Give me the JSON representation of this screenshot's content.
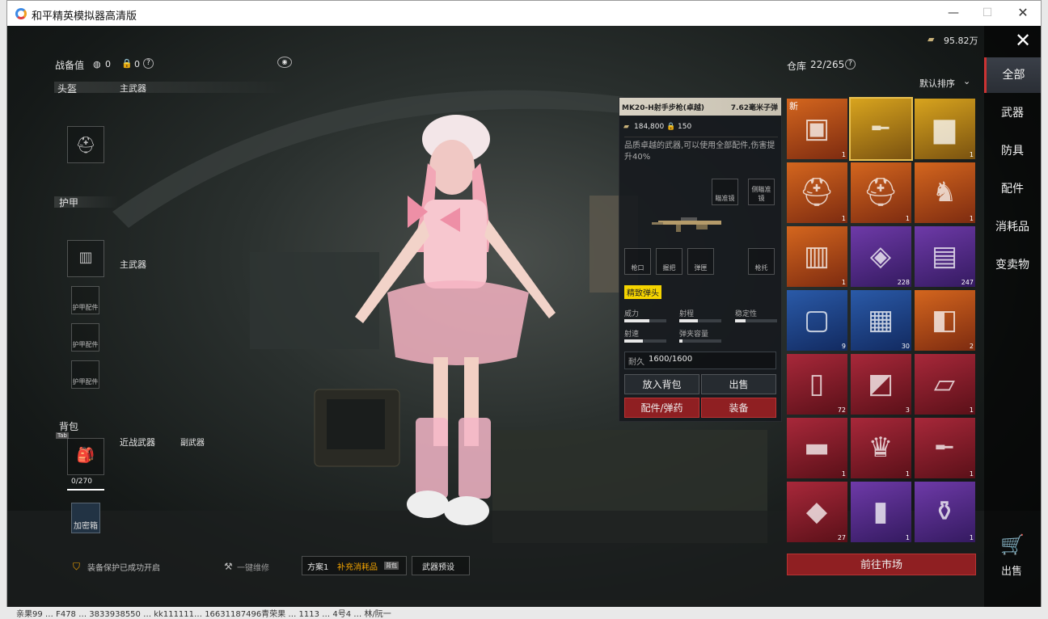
{
  "window": {
    "title": "和平精英模拟器高清版"
  },
  "left": {
    "gear_value_label": "战备值",
    "gear_value": "0",
    "lock_value": "0",
    "helmet": "头盔",
    "main_weapon": "主武器",
    "armor": "护甲",
    "main_weapon2": "主武器",
    "armor_part": "护甲配件",
    "backpack": "背包",
    "backpack_tab": "Tab",
    "backpack_capacity": "0/270",
    "melee": "近战武器",
    "secondary": "副武器",
    "encrypt_box": "加密箱",
    "protect_text": "装备保护已成功开启",
    "repair": "一键维修",
    "plan": "方案1",
    "supply": "补充消耗品",
    "supply_tag": "背包",
    "weapon_preset": "武器预设"
  },
  "currency": "95.82万",
  "storage": {
    "label": "仓库",
    "count": "22/265",
    "sort": "默认排序"
  },
  "info": {
    "name": "MK20-H射手步枪(卓越)",
    "caliber": "7.62毫米子弹",
    "price": "184,800",
    "weight": "150",
    "desc": "品质卓越的武器,可以使用全部配件,伤害提升40%",
    "slots": [
      "瞄准镜",
      "侧瞄准镜",
      "枪口",
      "握把",
      "弹匣",
      "枪托"
    ],
    "ammo_tag": "精致弹头",
    "stats": [
      {
        "name": "威力",
        "v": 0.6
      },
      {
        "name": "射程",
        "v": 0.45
      },
      {
        "name": "稳定性",
        "v": 0.25
      },
      {
        "name": "射速",
        "v": 0.45
      },
      {
        "name": "弹夹容量",
        "v": 0.08
      }
    ],
    "durability_label": "耐久",
    "durability": "1600/1600",
    "btn_pack": "放入背包",
    "btn_sell": "出售",
    "btn_parts": "配件/弹药",
    "btn_equip": "装备"
  },
  "grid": [
    {
      "name": "supply-crate",
      "bg": "orange",
      "count": "1",
      "tag": "新"
    },
    {
      "name": "rifle",
      "bg": "gold",
      "count": "",
      "tag": ""
    },
    {
      "name": "backpack",
      "bg": "gold",
      "count": "1",
      "tag": ""
    },
    {
      "name": "helmet",
      "bg": "orange",
      "count": "1",
      "tag": ""
    },
    {
      "name": "helmet",
      "bg": "orange",
      "count": "1",
      "tag": ""
    },
    {
      "name": "armor-suit",
      "bg": "orange",
      "count": "1",
      "tag": ""
    },
    {
      "name": "vest",
      "bg": "orange",
      "count": "1",
      "tag": ""
    },
    {
      "name": "ticket",
      "bg": "purple",
      "count": "228",
      "tag": ""
    },
    {
      "name": "ammo-box",
      "bg": "purple",
      "count": "247",
      "tag": ""
    },
    {
      "name": "silver-case",
      "bg": "blue",
      "count": "9",
      "tag": ""
    },
    {
      "name": "metal-case",
      "bg": "blue",
      "count": "30",
      "tag": ""
    },
    {
      "name": "gold-card",
      "bg": "orange",
      "count": "2",
      "tag": ""
    },
    {
      "name": "book",
      "bg": "red2",
      "count": "72",
      "tag": ""
    },
    {
      "name": "blue-card",
      "bg": "red2",
      "count": "3",
      "tag": ""
    },
    {
      "name": "map",
      "bg": "red2",
      "count": "1",
      "tag": ""
    },
    {
      "name": "gold-bar",
      "bg": "red2",
      "count": "1",
      "tag": ""
    },
    {
      "name": "trophy",
      "bg": "red2",
      "count": "1",
      "tag": ""
    },
    {
      "name": "gun",
      "bg": "red2",
      "count": "1",
      "tag": ""
    },
    {
      "name": "diamonds",
      "bg": "red2",
      "count": "27",
      "tag": ""
    },
    {
      "name": "passport",
      "bg": "purple",
      "count": "1",
      "tag": ""
    },
    {
      "name": "bottle",
      "bg": "purple",
      "count": "1",
      "tag": ""
    }
  ],
  "market_btn": "前往市场",
  "tabs": [
    "全部",
    "武器",
    "防具",
    "配件",
    "消耗品",
    "变卖物"
  ],
  "sell_label": "出售",
  "bg_text": "亲果99 … F478 … 3833938550 … kk111111… 16631187496青荣果 … 1113 … 4号4 … 林/阮一"
}
